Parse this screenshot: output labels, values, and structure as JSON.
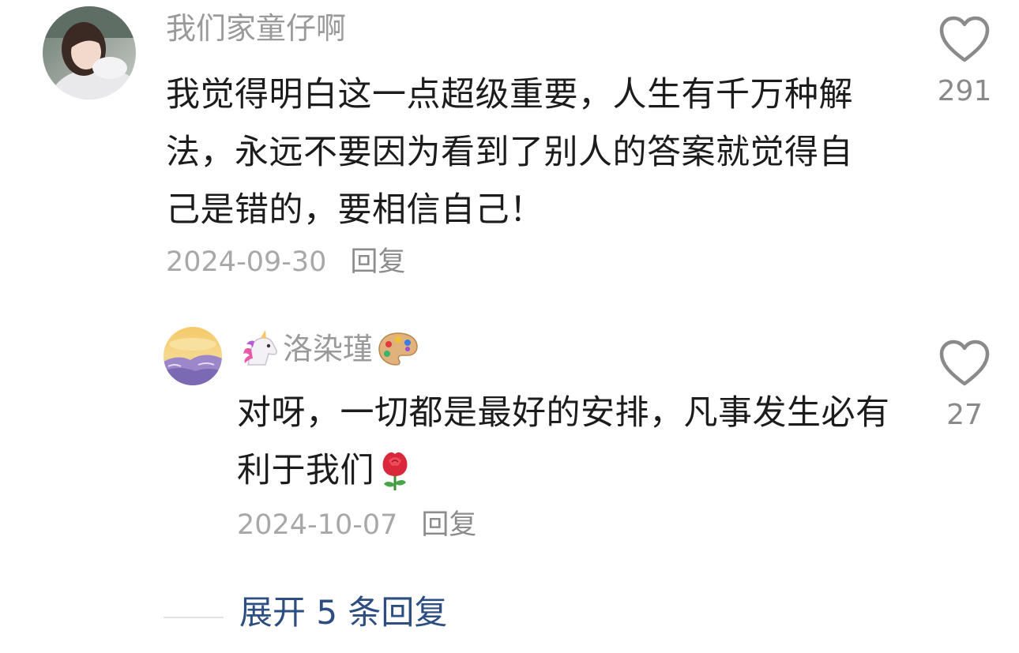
{
  "comment": {
    "username": "我们家童仔啊",
    "text": "我觉得明白这一点超级重要，人生有千万种解法，永远不要因为看到了别人的答案就觉得自己是错的，要相信自己！",
    "date": "2024-09-30",
    "reply_label": "回复",
    "like_count": "291",
    "avatar_icon": "avatar-photo"
  },
  "reply": {
    "username": "洛染瑾",
    "username_prefix_icon": "unicorn-emoji",
    "username_suffix_icon": "palette-emoji",
    "text": "对呀，一切都是最好的安排，凡事发生必有利于我们",
    "text_suffix_icon": "rose-emoji",
    "date": "2024-10-07",
    "reply_label": "回复",
    "like_count": "27",
    "avatar_icon": "sunset-landscape-avatar"
  },
  "expand": {
    "label": "展开 5 条回复"
  },
  "colors": {
    "username": "#9a9a9a",
    "text": "#1c1c1c",
    "meta": "#a8a8a8",
    "link": "#2d4e80",
    "heart": "#8a8a8a"
  }
}
